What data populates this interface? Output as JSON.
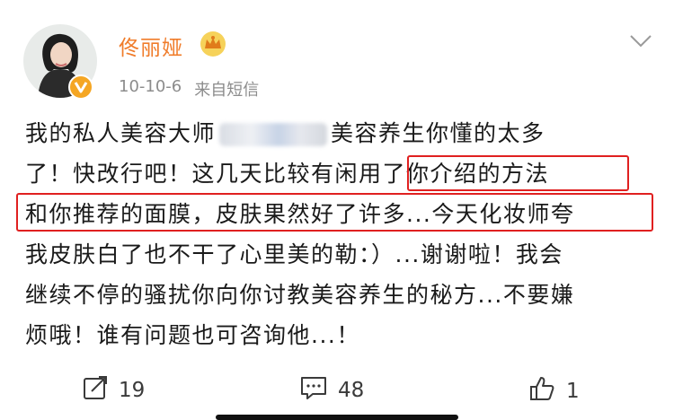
{
  "user": {
    "name": "佟丽娅",
    "badge_icon": "gold-crown-icon",
    "verified_icon": "verified-v-icon"
  },
  "post": {
    "date": "10-10-6",
    "source": "来自短信",
    "lines": {
      "l1a": "我的私人美容大师",
      "l1b": "美容养生你懂的太多",
      "l2": "了！快改行吧！这几天比较有闲用了你介绍的方法",
      "l3": "和你推荐的面膜，皮肤果然好了许多...今天化妆师夸",
      "l4": "我皮肤白了也不干了心里美的勒：）...谢谢啦！我会",
      "l5": "继续不停的骚扰你向你讨教美容养生的秘方...不要嫌",
      "l6": "烦哦！谁有问题也可咨询他...！"
    },
    "highlight_color": "#e02020"
  },
  "actions": {
    "repost_count": "19",
    "comment_count": "48",
    "like_count": "1"
  },
  "colors": {
    "username": "#f07c2a",
    "meta": "#8c8c8c",
    "text": "#1a1a1a"
  }
}
